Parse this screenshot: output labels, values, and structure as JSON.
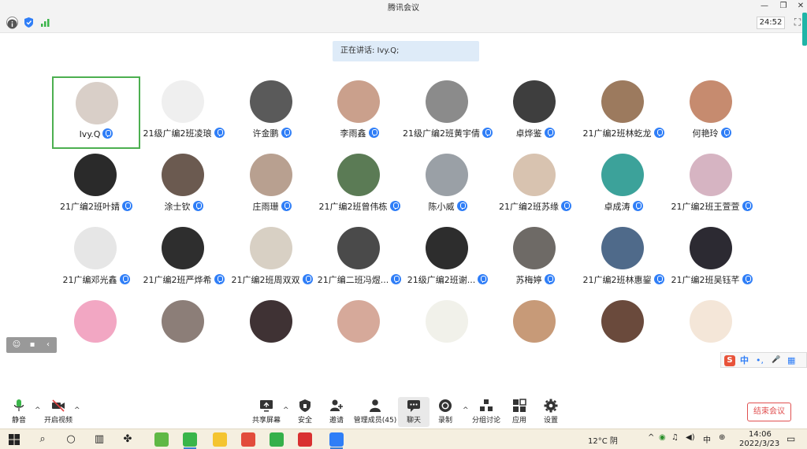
{
  "window": {
    "title": "腾讯会议",
    "min": "—",
    "max": "❐",
    "close": "✕"
  },
  "infobar": {
    "timer": "24:52",
    "fullscreen": "⛶"
  },
  "speaking": "正在讲话: Ivy.Q;",
  "participants": [
    {
      "name": "Ivy.Q",
      "color": "#d9cfc8",
      "active": true
    },
    {
      "name": "21级广编2班凌琅",
      "color": "#efefef"
    },
    {
      "name": "许金鹏",
      "color": "#5a5a5a"
    },
    {
      "name": "李雨鑫",
      "color": "#caa08c"
    },
    {
      "name": "21级广编2班黄宇倩",
      "color": "#8b8b8b"
    },
    {
      "name": "卓烨鉴",
      "color": "#3e3e3e"
    },
    {
      "name": "21广编2班林虼龙",
      "color": "#9c7a5e"
    },
    {
      "name": "何艳玲",
      "color": "#c68b6f"
    },
    {
      "name": "21广编2班叶婧",
      "color": "#2a2a2a"
    },
    {
      "name": "涂士钦",
      "color": "#6b5a50"
    },
    {
      "name": "庄雨珊",
      "color": "#b8a090"
    },
    {
      "name": "21广编2班曾伟栋",
      "color": "#5b7b55"
    },
    {
      "name": "陈小威",
      "color": "#9aa0a6"
    },
    {
      "name": "21广编2班苏缘",
      "color": "#d8c3b0"
    },
    {
      "name": "卓成涛",
      "color": "#3ca29a"
    },
    {
      "name": "21广编2班王萱萱",
      "color": "#d6b4c2"
    },
    {
      "name": "21广编邓光鑫",
      "color": "#e6e6e6"
    },
    {
      "name": "21广编2班严烨希",
      "color": "#2e2e2e"
    },
    {
      "name": "21广编2班周双双",
      "color": "#d8d0c4"
    },
    {
      "name": "21广编二班冯煜...",
      "color": "#4a4a4a"
    },
    {
      "name": "21级广编2班谢...",
      "color": "#2d2d2d"
    },
    {
      "name": "苏梅婷",
      "color": "#6e6a66"
    },
    {
      "name": "21广编2班林惠鋆",
      "color": "#4f6a8a"
    },
    {
      "name": "21广编2班吴钰芊",
      "color": "#2c2a32"
    },
    {
      "name": "",
      "color": "#f2a7c3"
    },
    {
      "name": "",
      "color": "#8c7e78"
    },
    {
      "name": "",
      "color": "#3f3234"
    },
    {
      "name": "",
      "color": "#d6a99a"
    },
    {
      "name": "",
      "color": "#f1f1ea"
    },
    {
      "name": "",
      "color": "#c79a78"
    },
    {
      "name": "",
      "color": "#6a4a3c"
    },
    {
      "name": "",
      "color": "#f4e6d8"
    }
  ],
  "ime": {
    "logo": "S",
    "lang": "中",
    "punct": "•,",
    "mic": "🎤",
    "kb": "▦"
  },
  "toolbar": {
    "mute": "静音",
    "video": "开启视频",
    "share": "共享屏幕",
    "security": "安全",
    "invite": "邀请",
    "members": "管理成员(45)",
    "chat": "聊天",
    "record": "录制",
    "breakout": "分组讨论",
    "apps": "应用",
    "settings": "设置",
    "end": "结束会议"
  },
  "taskbar": {
    "weather": "12°C 阴",
    "time": "14:06",
    "date": "2022/3/23"
  }
}
